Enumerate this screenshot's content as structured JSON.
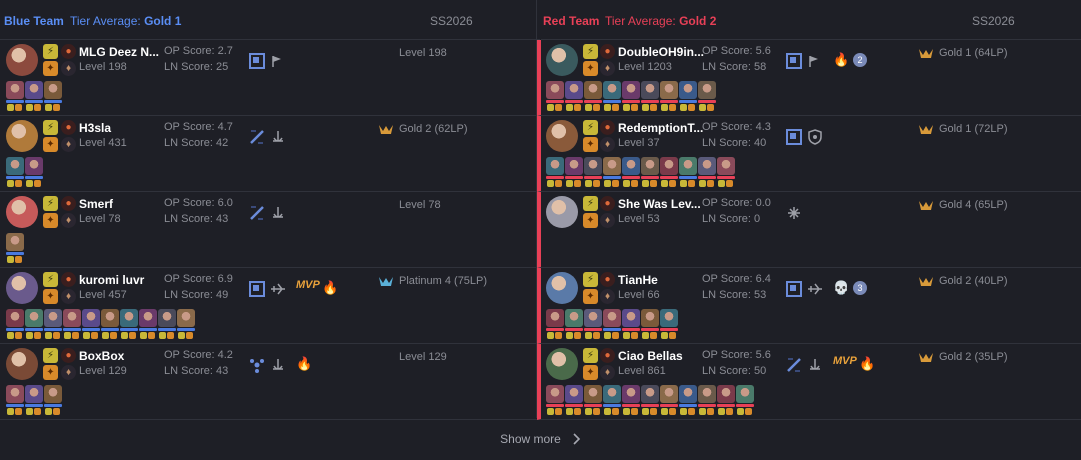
{
  "blue_team": {
    "name": "Blue Team",
    "tier_label": "Tier Average:",
    "tier_value": "Gold 1",
    "season": "SS2026",
    "players": [
      {
        "name": "MLG Deez N...",
        "level": "Level 198",
        "op_score": "OP Score: 2.7",
        "ln_score": "LN Score: 25",
        "rank": "Level 198",
        "rank_icon": false,
        "roles": [
          "lane-box-icon",
          "flag-icon"
        ],
        "badges": [],
        "champs": 3,
        "avatar_color": "#8c4a3e"
      },
      {
        "name": "H3sla",
        "level": "Level 431",
        "op_score": "OP Score: 4.7",
        "ln_score": "LN Score: 42",
        "rank": "Gold 2 (62LP)",
        "rank_icon": true,
        "roles": [
          "slash-icon",
          "anchor-icon"
        ],
        "badges": [],
        "champs": 2,
        "avatar_color": "#b07a3a"
      },
      {
        "name": "Smerf",
        "level": "Level 78",
        "op_score": "OP Score: 6.0",
        "ln_score": "LN Score: 43",
        "rank": "Level 78",
        "rank_icon": false,
        "roles": [
          "slash-icon",
          "anchor-icon"
        ],
        "badges": [],
        "champs": 1,
        "avatar_color": "#c65a5a"
      },
      {
        "name": "kuromi luvr",
        "level": "Level 457",
        "op_score": "OP Score: 6.9",
        "ln_score": "LN Score: 49",
        "rank": "Platinum 4 (75LP)",
        "rank_icon": true,
        "roles": [
          "lane-box-icon",
          "plane-icon"
        ],
        "badges": [
          "MVP",
          "🔥"
        ],
        "champs": 10,
        "avatar_color": "#6a5a8c"
      },
      {
        "name": "BoxBox",
        "level": "Level 129",
        "op_score": "OP Score: 4.2",
        "ln_score": "LN Score: 43",
        "rank": "Level 129",
        "rank_icon": false,
        "roles": [
          "tri-icon",
          "anchor-icon"
        ],
        "badges": [
          "🔥"
        ],
        "champs": 3,
        "avatar_color": "#7a4a36"
      }
    ]
  },
  "red_team": {
    "name": "Red Team",
    "tier_label": "Tier Average:",
    "tier_value": "Gold 2",
    "season": "SS2026",
    "players": [
      {
        "name": "DoubleOH9in...",
        "level": "Level 1203",
        "op_score": "OP Score: 5.6",
        "ln_score": "LN Score: 58",
        "rank": "Gold 1 (64LP)",
        "rank_icon": true,
        "roles": [
          "lane-box-icon",
          "flag-icon"
        ],
        "badges": [
          "🔥",
          "2"
        ],
        "champs": 9,
        "avatar_color": "#3a5a5e"
      },
      {
        "name": "RedemptionT...",
        "level": "Level 37",
        "op_score": "OP Score: 4.3",
        "ln_score": "LN Score: 40",
        "rank": "Gold 1 (72LP)",
        "rank_icon": true,
        "roles": [
          "lane-box-icon",
          "shield-icon"
        ],
        "badges": [],
        "champs": 10,
        "avatar_color": "#8a5a3a"
      },
      {
        "name": "She Was Lev...",
        "level": "Level 53",
        "op_score": "OP Score: 0.0",
        "ln_score": "LN Score: 0",
        "rank": "Gold 4 (65LP)",
        "rank_icon": true,
        "roles": [
          "asterisk-icon"
        ],
        "badges": [],
        "champs": 0,
        "avatar_color": "#9a9aa8"
      },
      {
        "name": "TianHe",
        "level": "Level 66",
        "op_score": "OP Score: 6.4",
        "ln_score": "LN Score: 53",
        "rank": "Gold 2 (40LP)",
        "rank_icon": true,
        "roles": [
          "lane-box-icon",
          "plane-icon"
        ],
        "badges": [
          "💀",
          "3"
        ],
        "champs": 7,
        "avatar_color": "#5a7aa8"
      },
      {
        "name": "Ciao Bellas",
        "level": "Level 861",
        "op_score": "OP Score: 5.6",
        "ln_score": "LN Score: 50",
        "rank": "Gold 2 (35LP)",
        "rank_icon": true,
        "roles": [
          "slash-icon",
          "anchor-icon"
        ],
        "badges": [
          "MVP",
          "🔥"
        ],
        "champs": 11,
        "avatar_color": "#4a6a4a"
      }
    ]
  },
  "footer": {
    "show_more": "Show more"
  },
  "colors": {
    "blue": "#5a8ef5",
    "red": "#e84057",
    "gold": "#e9a23b",
    "bg": "#1e1f26"
  }
}
